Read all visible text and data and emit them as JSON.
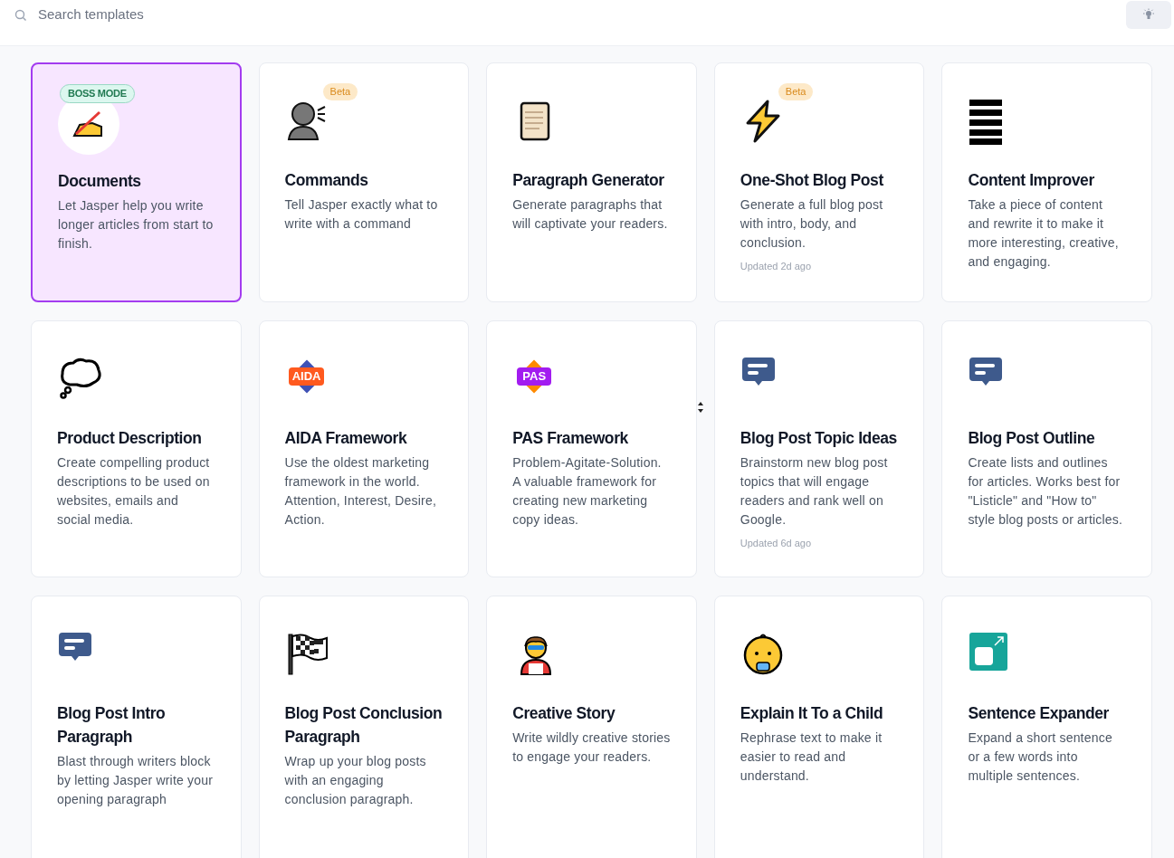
{
  "search": {
    "placeholder": "Search templates"
  },
  "templates": [
    {
      "title": "Documents",
      "description": "Let Jasper help you write longer articles from start to finish.",
      "kind": "writing-hand",
      "badge": {
        "kind": "boss",
        "label": "BOSS MODE"
      },
      "selected": true
    },
    {
      "title": "Commands",
      "description": "Tell Jasper exactly what to write with a command",
      "kind": "speaking-head",
      "badge": {
        "kind": "beta",
        "label": "Beta"
      },
      "selected": false
    },
    {
      "title": "Paragraph Generator",
      "description": "Generate paragraphs that will captivate your readers.",
      "kind": "scroll",
      "selected": false
    },
    {
      "title": "One-Shot Blog Post",
      "description": "Generate a full blog post with intro, body, and conclusion.",
      "kind": "lightning",
      "badge": {
        "kind": "beta",
        "label": "Beta"
      },
      "updated": "Updated 2d ago",
      "selected": false
    },
    {
      "title": "Content Improver",
      "description": "Take a piece of content and rewrite it to make it more interesting, creative, and engaging.",
      "kind": "bars",
      "selected": false
    },
    {
      "title": "Product Description",
      "description": "Create compelling product descriptions to be used on websites, emails and social media.",
      "kind": "thought-bubble",
      "selected": false
    },
    {
      "title": "AIDA Framework",
      "description": "Use the oldest marketing framework in the world. Attention, Interest, Desire, Action.",
      "kind": "aida",
      "icon_text": "AIDA",
      "selected": false
    },
    {
      "title": "PAS Framework",
      "description": "Problem-Agitate-Solution. A valuable framework for creating new marketing copy ideas.",
      "kind": "pas",
      "icon_text": "PAS",
      "selected": false
    },
    {
      "title": "Blog Post Topic Ideas",
      "description": "Brainstorm new blog post topics that will engage readers and rank well on Google.",
      "kind": "chat",
      "updated": "Updated 6d ago",
      "selected": false
    },
    {
      "title": "Blog Post Outline",
      "description": "Create lists and outlines for articles. Works best for \"Listicle\" and \"How to\" style blog posts or articles.",
      "kind": "chat",
      "selected": false
    },
    {
      "title": "Blog Post Intro Paragraph",
      "description": "Blast through writers block by letting Jasper write your opening paragraph",
      "kind": "chat",
      "selected": false
    },
    {
      "title": "Blog Post Conclusion Paragraph",
      "description": "Wrap up your blog posts with an engaging conclusion paragraph.",
      "kind": "flag",
      "selected": false
    },
    {
      "title": "Creative Story",
      "description": "Write wildly creative stories to engage your readers.",
      "kind": "hero",
      "selected": false
    },
    {
      "title": "Explain It To a Child",
      "description": "Rephrase text to make it easier to read and understand.",
      "kind": "baby",
      "selected": false
    },
    {
      "title": "Sentence Expander",
      "description": "Expand a short sentence or a few words into multiple sentences.",
      "kind": "expand",
      "selected": false
    }
  ]
}
